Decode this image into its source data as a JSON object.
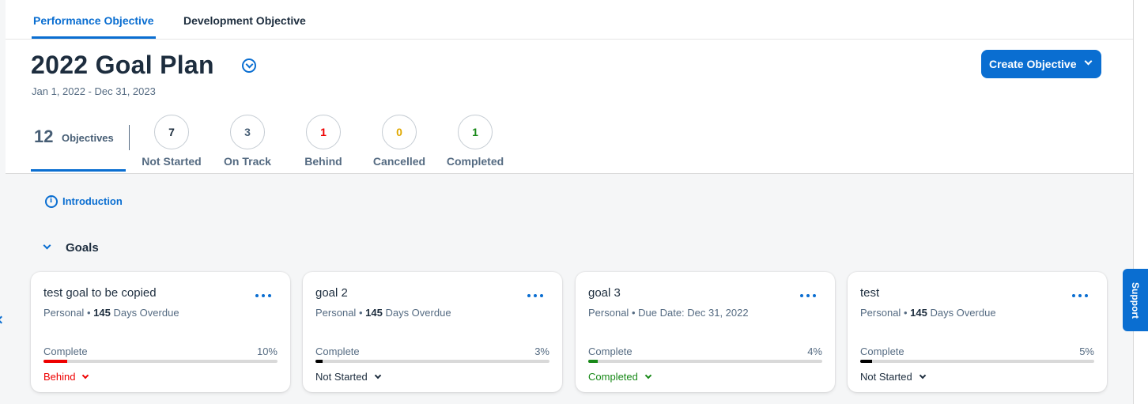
{
  "tabs": [
    {
      "label": "Performance Objective",
      "active": true
    },
    {
      "label": "Development Objective",
      "active": false
    }
  ],
  "plan": {
    "title": "2022 Goal Plan",
    "date_range": "Jan 1, 2022 - Dec 31, 2023"
  },
  "create_button": {
    "label": "Create Objective"
  },
  "objectives": {
    "count": "12",
    "label": "Objectives",
    "statuses": [
      {
        "count": "7",
        "label": "Not Started",
        "color": "#1d2d3e"
      },
      {
        "count": "3",
        "label": "On Track",
        "color": "#475e75"
      },
      {
        "count": "1",
        "label": "Behind",
        "color": "#e00"
      },
      {
        "count": "0",
        "label": "Cancelled",
        "color": "#e0a800"
      },
      {
        "count": "1",
        "label": "Completed",
        "color": "#188918"
      }
    ]
  },
  "introduction": {
    "label": "Introduction",
    "icon": "info-icon"
  },
  "goals_section": {
    "label": "Goals"
  },
  "cards": [
    {
      "title": "test goal to be copied",
      "type": "Personal",
      "bullet": "•",
      "days": "145",
      "days_label": "Days Overdue",
      "progress_label": "Complete",
      "progress_text": "10%",
      "progress": 10,
      "bar_color": "#e00",
      "status": "Behind",
      "status_color": "#e00"
    },
    {
      "title": "goal 2",
      "type": "Personal",
      "bullet": "•",
      "days": "145",
      "days_label": "Days Overdue",
      "progress_label": "Complete",
      "progress_text": "3%",
      "progress": 3,
      "bar_color": "#000000",
      "status": "Not Started",
      "status_color": "#1d2d3e"
    },
    {
      "title": "goal 3",
      "type": "Personal",
      "bullet": "•",
      "due": "Due Date: Dec 31, 2022",
      "progress_label": "Complete",
      "progress_text": "4%",
      "progress": 4,
      "bar_color": "#188918",
      "status": "Completed",
      "status_color": "#188918"
    },
    {
      "title": "test",
      "type": "Personal",
      "bullet": "•",
      "days": "145",
      "days_label": "Days Overdue",
      "progress_label": "Complete",
      "progress_text": "5%",
      "progress": 5,
      "bar_color": "#000000",
      "status": "Not Started",
      "status_color": "#1d2d3e"
    }
  ],
  "support": {
    "label": "Support"
  },
  "colors": {
    "accent": "#0a6ed1",
    "text": "#1d2d3e",
    "muted": "#556b82"
  }
}
